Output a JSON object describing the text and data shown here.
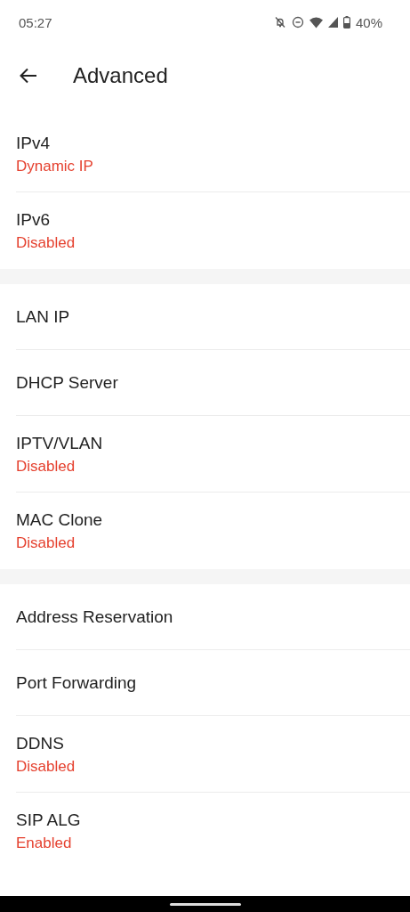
{
  "status_bar": {
    "time": "05:27",
    "battery": "40%"
  },
  "header": {
    "title": "Advanced"
  },
  "groups": [
    {
      "items": [
        {
          "title": "IPv4",
          "subtitle": "Dynamic IP"
        },
        {
          "title": "IPv6",
          "subtitle": "Disabled"
        }
      ]
    },
    {
      "items": [
        {
          "title": "LAN IP"
        },
        {
          "title": "DHCP Server"
        },
        {
          "title": "IPTV/VLAN",
          "subtitle": "Disabled"
        },
        {
          "title": "MAC Clone",
          "subtitle": "Disabled"
        }
      ]
    },
    {
      "items": [
        {
          "title": "Address Reservation"
        },
        {
          "title": "Port Forwarding"
        },
        {
          "title": "DDNS",
          "subtitle": "Disabled"
        },
        {
          "title": "SIP ALG",
          "subtitle": "Enabled"
        }
      ]
    }
  ]
}
